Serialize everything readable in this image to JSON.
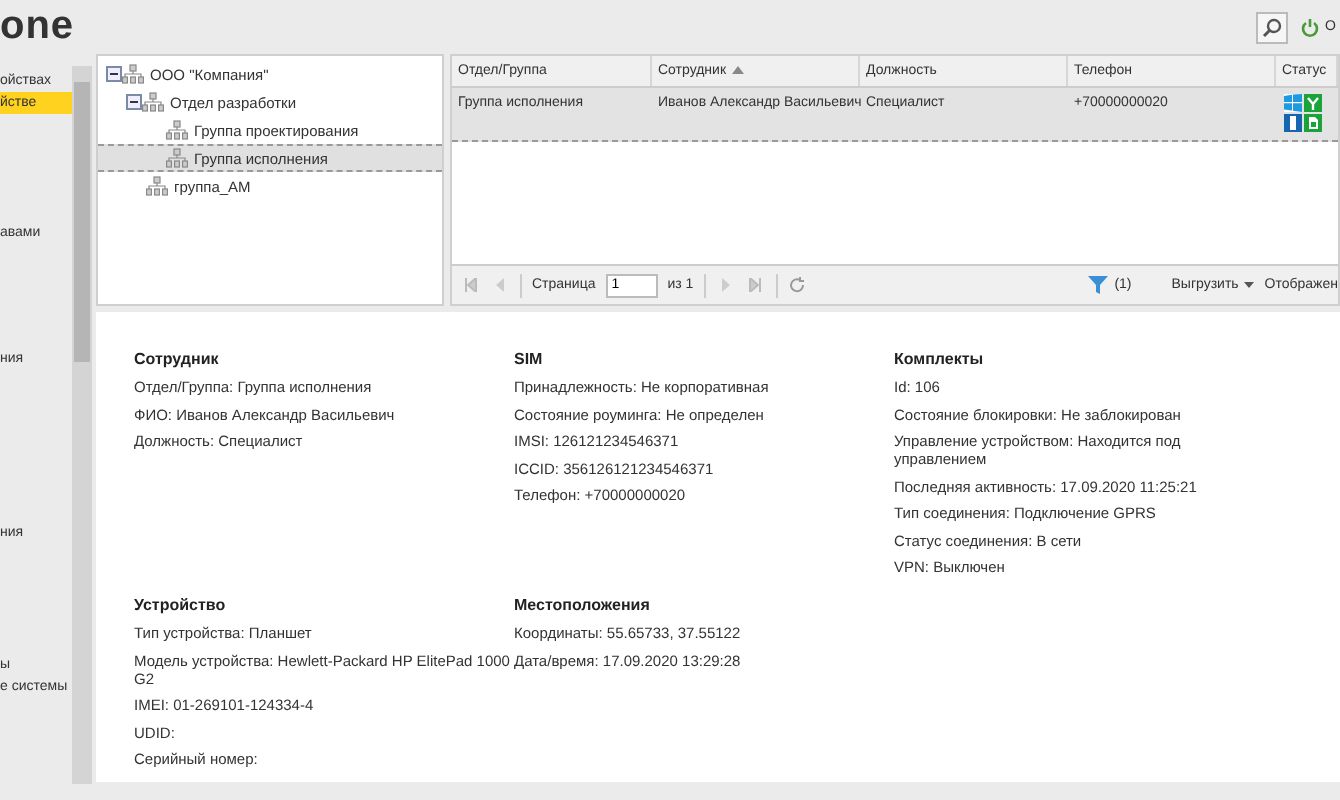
{
  "header": {
    "logo": "one",
    "user_label": "О"
  },
  "sidebar": {
    "items": [
      {
        "label": "ойствах",
        "selected": false
      },
      {
        "label": "йстве",
        "selected": true
      },
      {
        "label": "авами",
        "selected": false
      },
      {
        "label": "ния",
        "selected": false
      },
      {
        "label": "ния",
        "selected": false
      },
      {
        "label": "ы",
        "selected": false
      },
      {
        "label": "е системы",
        "selected": false
      }
    ]
  },
  "tree": [
    {
      "label": "ООО \"Компания\"",
      "selected": false,
      "expanded": true,
      "children": [
        {
          "label": "Отдел разработки",
          "selected": false,
          "expanded": true,
          "children": [
            {
              "label": "Группа проектирования",
              "selected": false
            },
            {
              "label": "Группа исполнения",
              "selected": true
            }
          ]
        },
        {
          "label": "группа_АМ",
          "selected": false
        }
      ]
    }
  ],
  "grid": {
    "columns": [
      {
        "label": "Отдел/Группа",
        "sorted": false
      },
      {
        "label": "Сотрудник",
        "sorted": true
      },
      {
        "label": "Должность",
        "sorted": false
      },
      {
        "label": "Телефон",
        "sorted": false
      },
      {
        "label": "Статус",
        "sorted": false
      }
    ],
    "rows": [
      {
        "cells": [
          "Группа исполнения",
          "Иванов Александр Васильевич",
          "Специалист",
          "+70000000020"
        ],
        "selected": true
      }
    ],
    "pager": {
      "page_label": "Страница",
      "page": "1",
      "of_label": "из 1",
      "filter_count": "(1)",
      "export": "Выгрузить",
      "display": "Отображен"
    }
  },
  "details": [
    {
      "title": "Сотрудник",
      "lines": [
        "Отдел/Группа: Группа исполнения",
        "ФИО: Иванов Александр Васильевич",
        "Должность: Специалист"
      ]
    },
    {
      "title": "SIM",
      "lines": [
        "Принадлежность: Не корпоративная",
        "Состояние роуминга: Не определен",
        "IMSI: 126121234546371",
        "ICCID: 356126121234546371",
        "Телефон: +70000000020"
      ]
    },
    {
      "title": "Комплекты",
      "lines": [
        "Id: 106",
        "Состояние блокировки: Не заблокирован",
        "Управление устройством: Находится под управлением",
        "Последняя активность: 17.09.2020 11:25:21",
        "Тип соединения: Подключение GPRS",
        "Статус соединения: В сети",
        "VPN: Выключен"
      ]
    },
    {
      "title": "Устройство",
      "lines": [
        "Тип устройства: Планшет",
        "Модель устройства: Hewlett-Packard HP ElitePad 1000 G2",
        "IMEI: 01-269101-124334-4",
        "UDID:",
        "Серийный номер:"
      ]
    },
    {
      "title": "Местоположения",
      "lines": [
        "Координаты: 55.65733, 37.55122",
        "Дата/время: 17.09.2020 13:29:28"
      ]
    }
  ]
}
